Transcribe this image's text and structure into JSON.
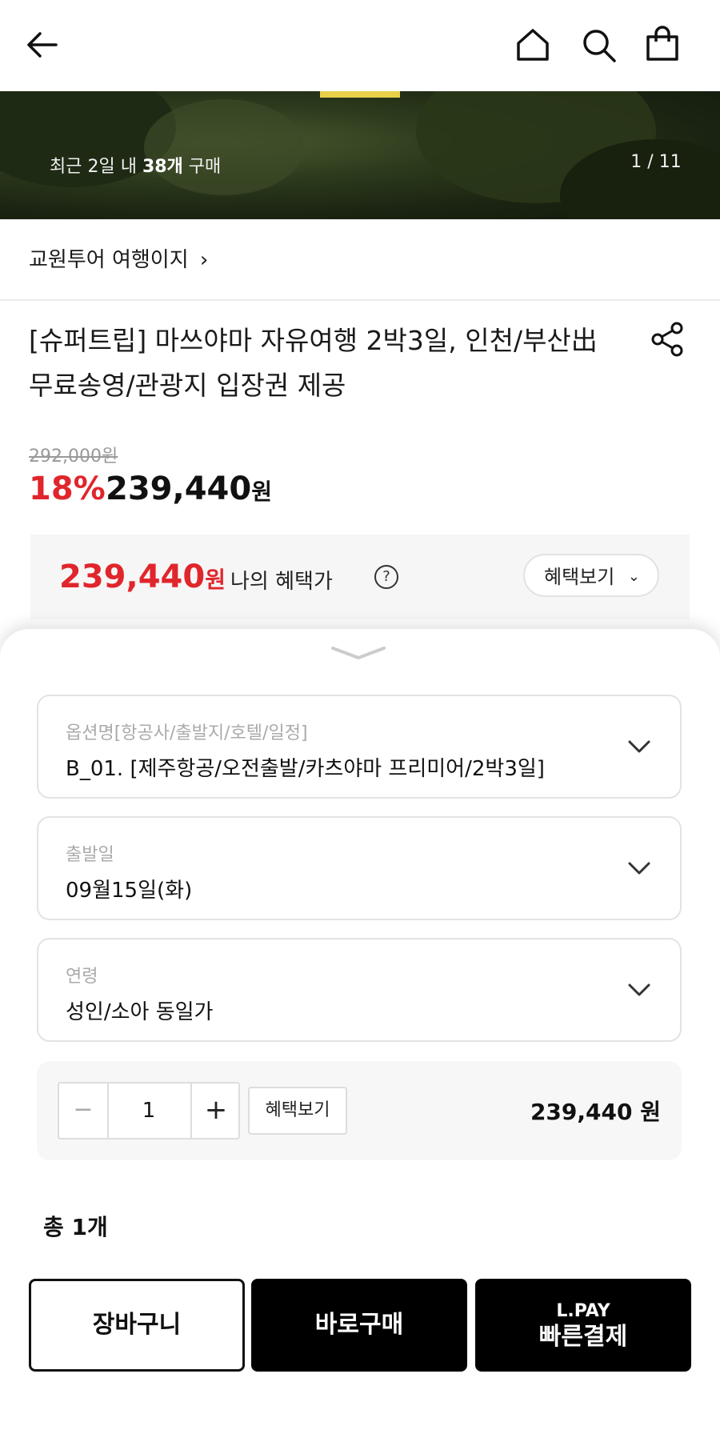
{
  "topbar": {
    "back_icon": "arrow-left-icon",
    "home_icon": "home-icon",
    "search_icon": "search-icon",
    "cart_icon": "shopping-bag-icon"
  },
  "hero": {
    "recent_prefix": "최근 2일 내 ",
    "recent_count": "38개",
    "recent_suffix": " 구매",
    "counter": "1 / 11"
  },
  "store": {
    "label": "교원투어 여행이지",
    "chevron": "›"
  },
  "product": {
    "title": "[슈퍼트립] 마쓰야마 자유여행 2박3일, 인천/부산出 무료송영/관광지 입장권 제공",
    "share_icon": "share-icon",
    "original_price": "292,000원",
    "discount": "18%",
    "price": "239,440",
    "price_unit": "원"
  },
  "benefit": {
    "price": "239,440",
    "unit": "원",
    "label": "나의 혜택가",
    "help": "?",
    "button": "혜택보기",
    "chevron": "⌄"
  },
  "options": [
    {
      "label": "옵션명[항공사/출발지/호텔/일정]",
      "value": "B_01. [제주항공/오전출발/카츠야마 프리미어/2박3일]"
    },
    {
      "label": "출발일",
      "value": "09월15일(화)"
    },
    {
      "label": "연령",
      "value": "성인/소아 동일가"
    }
  ],
  "quantity": {
    "minus": "−",
    "value": "1",
    "plus": "+",
    "benefit_button": "혜택보기",
    "price": "239,440 원"
  },
  "total": "총 1개",
  "actions": {
    "cart": "장바구니",
    "buy_now": "바로구매",
    "lpay_top": "L.PAY",
    "lpay_bottom": "빠른결제"
  },
  "colors": {
    "accent": "#e0262c",
    "black": "#000000"
  }
}
